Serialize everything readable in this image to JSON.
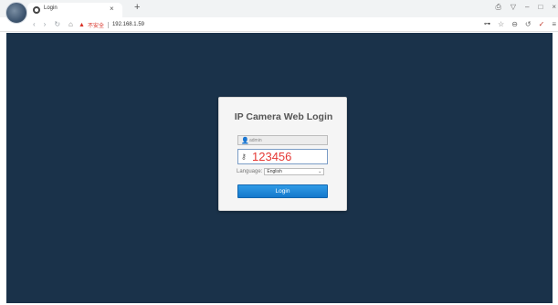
{
  "browser": {
    "tab": {
      "title": "Login",
      "close_glyph": "×",
      "favicon": "globe-icon"
    },
    "new_tab_glyph": "+",
    "window_controls": [
      "⎙",
      "▽",
      "–",
      "□",
      "×"
    ],
    "nav_glyphs": {
      "back": "‹",
      "forward": "›",
      "reload": "↻",
      "home": "⌂"
    },
    "security_warning": "不安全",
    "url": "192.168.1.59",
    "right_icons": {
      "key": "⊶",
      "star": "☆",
      "reader": "⊖",
      "undo": "↺",
      "extension": "✓",
      "menu": "≡"
    }
  },
  "login": {
    "title": "IP Camera Web Login",
    "username_placeholder": "admin",
    "password_value": "123456",
    "language_label": "Language:",
    "language_value": "English",
    "login_button": "Login"
  },
  "colors": {
    "page_background": "#1a324a",
    "card_background": "#f5f5f5",
    "button": "#1f8bd9",
    "password_text": "#e53935"
  }
}
